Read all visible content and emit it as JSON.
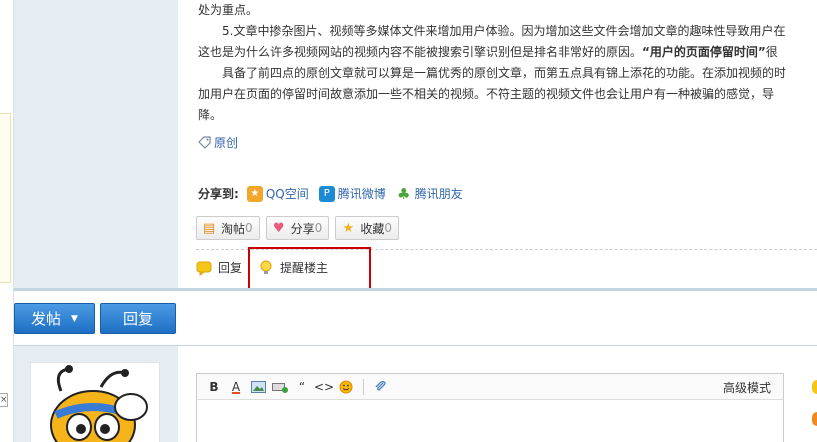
{
  "post": {
    "line1": "处为重点。",
    "line2": "　　5.文章中掺杂图片、视频等多媒体文件来增加用户体验。因为增加这些文件会增加文章的趣味性导致用户在",
    "line3_pre": "这也是为什么许多视频网站的视频内容不能被搜索引擎识别但是排名非常好的原因。",
    "line3_bold": "“用户的页面停留时间”",
    "line3_post": "很",
    "line4": "　　具备了前四点的原创文章就可以算是一篇优秀的原创文章，而第五点具有锦上添花的功能。在添加视频的时",
    "line5": "加用户在页面的停留时间故意添加一些不相关的视频。不符主题的视频文件也会让用户有一种被骗的感觉，导",
    "line6": "降。"
  },
  "tag": {
    "label": "原创"
  },
  "share": {
    "label": "分享到:",
    "items": [
      {
        "label": "QQ空间",
        "color": "#f2a62b"
      },
      {
        "label": "腾讯微博",
        "color": "#1e8ad1"
      },
      {
        "label": "腾讯朋友",
        "color": "#4aa33c"
      }
    ]
  },
  "actions": [
    {
      "label": "淘帖",
      "count": "0"
    },
    {
      "label": "分享",
      "count": "0"
    },
    {
      "label": "收藏",
      "count": "0"
    }
  ],
  "reply_bar": {
    "reply": "回复",
    "remind": "提醒楼主"
  },
  "bottom_bar": {
    "post_button": "发帖",
    "reply_button": "回复"
  },
  "editor": {
    "advanced_mode": "高级模式",
    "tools": [
      "B",
      "A",
      "image",
      "table",
      "“",
      "<>",
      "emoji",
      "attach"
    ]
  },
  "colors": {
    "accent": "#1d6fc3",
    "link": "#3366aa",
    "highlight": "#cc0000",
    "gutter": "#e5edf2"
  }
}
